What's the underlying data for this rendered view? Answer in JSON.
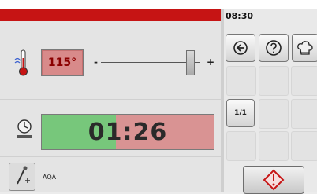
{
  "clock": "08:30",
  "temperature": {
    "value": "115°",
    "minus": "-",
    "plus": "+",
    "slider_level": 0.9
  },
  "timer": {
    "value": "01:26",
    "elapsed_fraction": 0.43
  },
  "probe": {
    "label": "AQA"
  },
  "right_panel": {
    "page_indicator": "1/1"
  },
  "icons": {
    "back": "back-arrow-icon",
    "help": "help-icon",
    "chef": "chef-hat-icon",
    "start": "start-diamond-icon"
  },
  "colors": {
    "header_red": "#c61414",
    "timer_green": "#77c77b",
    "timer_red": "#d99393",
    "temp_box": "#d88a8a",
    "temp_text": "#8b0000"
  }
}
